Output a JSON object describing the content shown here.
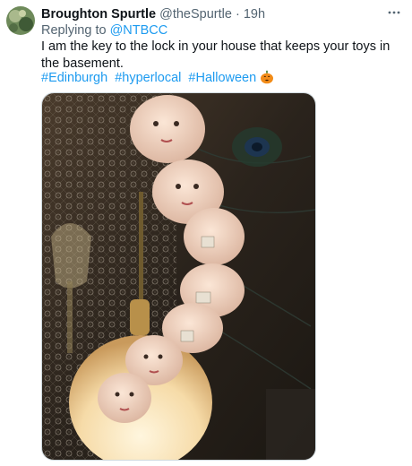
{
  "tweet": {
    "display_name": "Broughton Spurtle",
    "handle": "@theSpurtle",
    "separator": "·",
    "time": "19h",
    "more_icon": "more-horizontal-icon",
    "reply_prefix": "Replying to ",
    "reply_to": "@NTBCC",
    "text": "I am the key to the lock in your house that keeps your toys in the basement.",
    "hashtags": [
      "#Edinburgh",
      "#hyperlocal",
      "#Halloween"
    ],
    "emoji": "jack-o-lantern-icon"
  },
  "media": {
    "description_icon": "photo-doll-heads-lamp"
  }
}
